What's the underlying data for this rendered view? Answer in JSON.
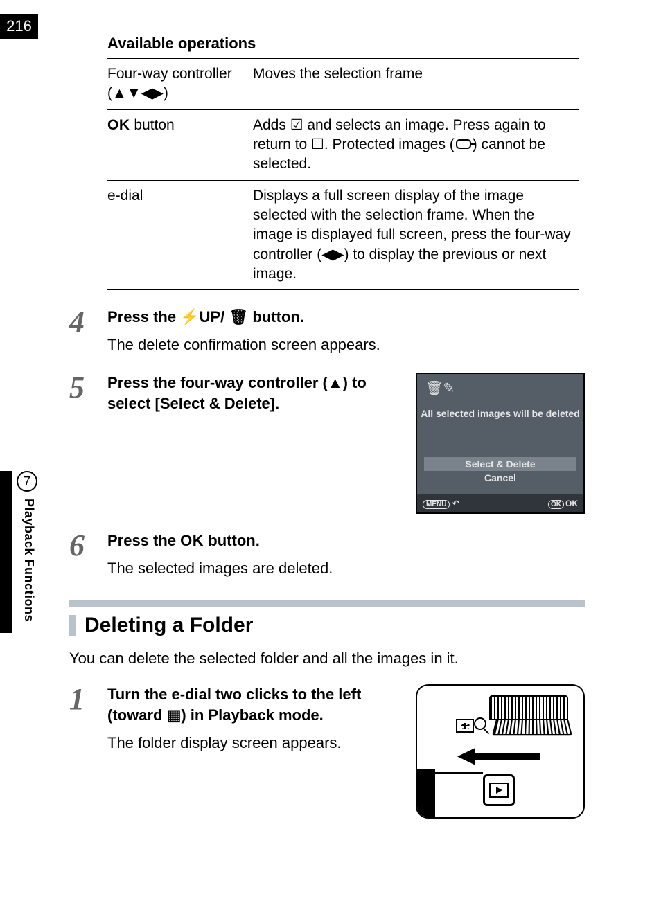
{
  "page_number": "216",
  "chapter_number": "7",
  "chapter_title": "Playback Functions",
  "available_operations": {
    "heading": "Available operations",
    "rows": [
      {
        "control_prefix": "Four-way controller",
        "control_symbols": "(▲▼◀▶)",
        "description": "Moves the selection frame"
      },
      {
        "control_label": "OK",
        "control_suffix": " button",
        "desc_part1": "Adds ",
        "desc_check": "☑",
        "desc_part2": " and selects an image. Press again to return to ",
        "desc_box": "☐",
        "desc_part3": ". Protected images (",
        "desc_part4": ") cannot be selected."
      },
      {
        "control_prefix": "e-dial",
        "description": "Displays a full screen display of the image selected with the selection frame. When the image is displayed full screen, press the four-way controller (◀▶) to display the previous or next image."
      }
    ]
  },
  "step4": {
    "num": "4",
    "title_prefix": "Press the ",
    "flash": "⚡UP",
    "slash": "/ ",
    "trash": "🗑",
    "title_suffix": " button.",
    "desc": "The delete confirmation screen appears."
  },
  "step5": {
    "num": "5",
    "title": "Press the four-way controller (▲) to select [Select & Delete].",
    "lcd": {
      "message": "All selected images will be deleted",
      "option_selected": "Select & Delete",
      "option_other": "Cancel",
      "menu_label": "MENU",
      "back_arrow": "↶",
      "ok_badge": "OK",
      "ok_text": "OK"
    }
  },
  "step6": {
    "num": "6",
    "title_prefix": "Press the ",
    "ok_label": "OK",
    "title_suffix": " button.",
    "desc": "The selected images are deleted."
  },
  "section_heading": "Deleting a Folder",
  "section_intro": "You can delete the selected folder and all the images in it.",
  "step1": {
    "num": "1",
    "title_part1": "Turn the e-dial two clicks to the left (toward ",
    "title_part2": ") in Playback mode.",
    "desc": "The folder display screen appears."
  }
}
